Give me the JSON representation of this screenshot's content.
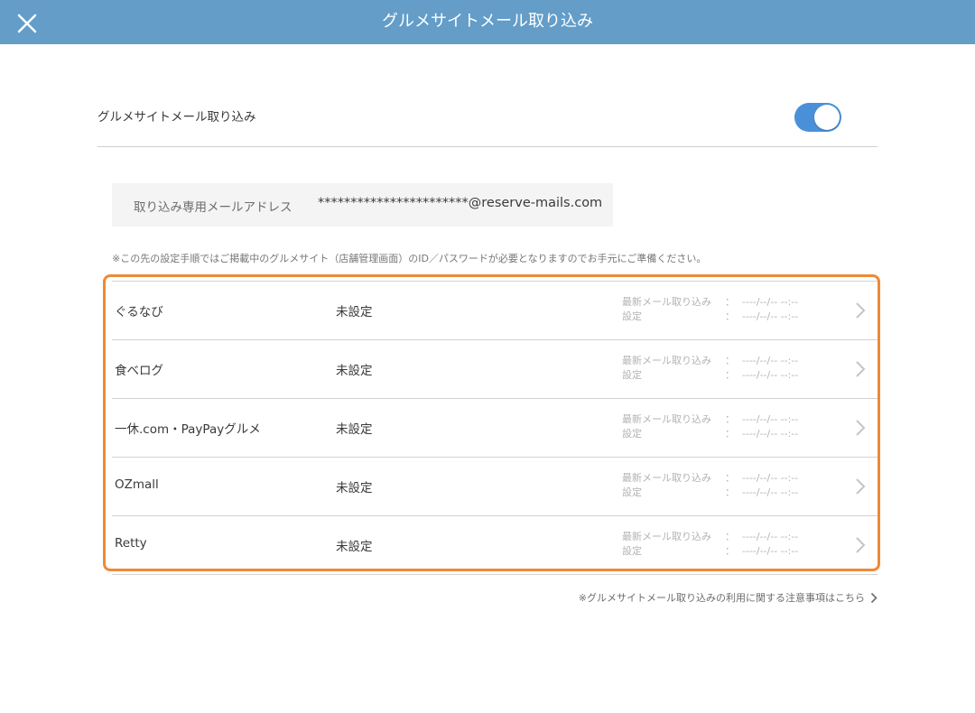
{
  "header": {
    "title": "グルメサイトメール取り込み",
    "close_icon": "close-icon"
  },
  "toggle_row": {
    "label": "グルメサイトメール取り込み",
    "enabled": true,
    "accent_color": "#4a90d9"
  },
  "address": {
    "label": "取り込み専用メールアドレス",
    "value": "***********************@reserve-mails.com"
  },
  "note": "※この先の設定手順ではご掲載中のグルメサイト（店舗管理画面）のID／パスワードが必要となりますのでお手元にご準備ください。",
  "highlight_color": "#ed8a36",
  "sites": [
    {
      "name": "ぐるなび",
      "status": "未設定",
      "last_mail_label": "最新メール取り込み",
      "last_mail_value": "----/--/-- --:--",
      "setting_label": "設定",
      "setting_value": "----/--/-- --:--"
    },
    {
      "name": "食べログ",
      "status": "未設定",
      "last_mail_label": "最新メール取り込み",
      "last_mail_value": "----/--/-- --:--",
      "setting_label": "設定",
      "setting_value": "----/--/-- --:--"
    },
    {
      "name": "一休.com・PayPayグルメ",
      "status": "未設定",
      "last_mail_label": "最新メール取り込み",
      "last_mail_value": "----/--/-- --:--",
      "setting_label": "設定",
      "setting_value": "----/--/-- --:--"
    },
    {
      "name": "OZmall",
      "status": "未設定",
      "last_mail_label": "最新メール取り込み",
      "last_mail_value": "----/--/-- --:--",
      "setting_label": "設定",
      "setting_value": "----/--/-- --:--"
    },
    {
      "name": "Retty",
      "status": "未設定",
      "last_mail_label": "最新メール取り込み",
      "last_mail_value": "----/--/-- --:--",
      "setting_label": "設定",
      "setting_value": "----/--/-- --:--"
    }
  ],
  "footer": {
    "link_text": "※グルメサイトメール取り込みの利用に関する注意事項はこちら",
    "icon": "chevron-right-icon"
  }
}
